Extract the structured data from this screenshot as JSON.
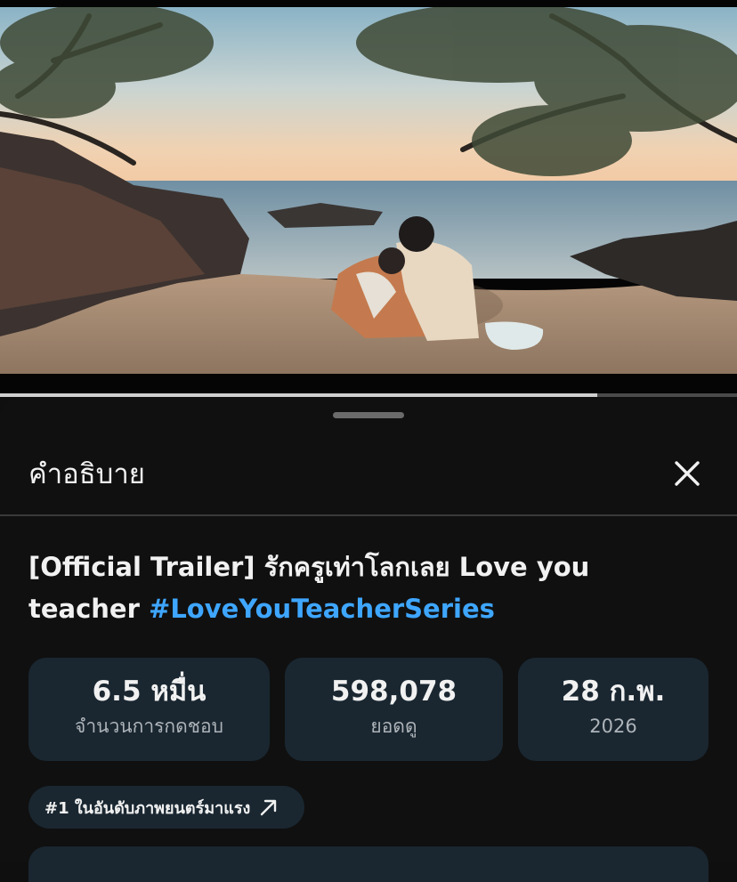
{
  "player": {
    "progress_fraction": 0.81
  },
  "sheet": {
    "title": "คำอธิบาย",
    "close_icon": "close-icon"
  },
  "video": {
    "title_prefix": "[Official Trailer] รักครูเท่าโลกเลย Love you teacher ",
    "hashtag": "#LoveYouTeacherSeries"
  },
  "stats": [
    {
      "value": "6.5 หมื่น",
      "label": "จำนวนการกดชอบ"
    },
    {
      "value": "598,078",
      "label": "ยอดดู"
    },
    {
      "value": "28 ก.พ.",
      "label": "2026"
    }
  ],
  "trending_chip": {
    "label": "#1 ในอันดับภาพยนตร์มาแรง",
    "icon": "arrow-up-right-icon"
  },
  "colors": {
    "background": "#0f0f0f",
    "card": "#1a2731",
    "link": "#3ea6ff"
  }
}
